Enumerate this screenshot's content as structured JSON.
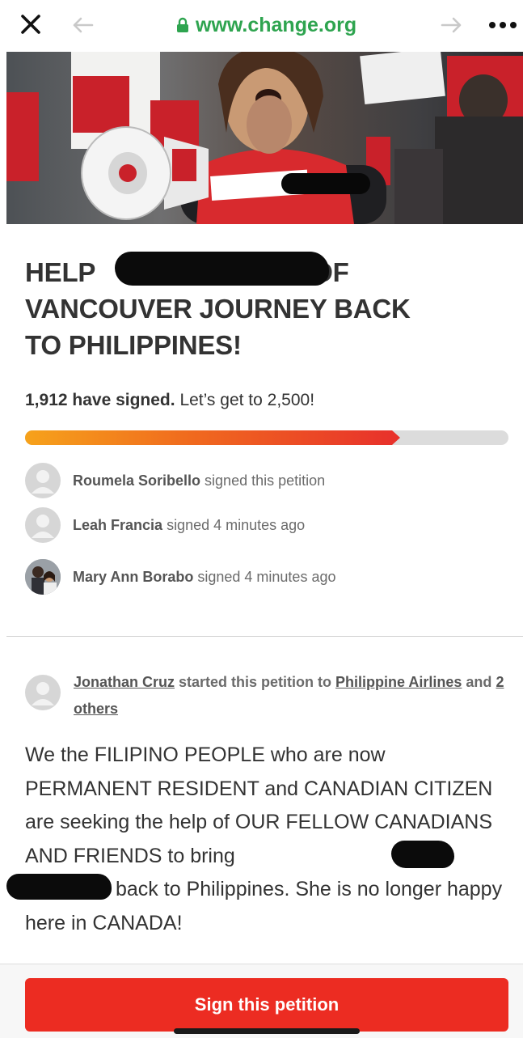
{
  "browser": {
    "url": "www.change.org",
    "icons": [
      "close-icon",
      "back-arrow-icon",
      "lock-icon",
      "forward-arrow-icon",
      "more-dots-icon"
    ]
  },
  "petition": {
    "title_line1_start": "HELP",
    "title_line1_end": "OF",
    "title_line2": "VANCOUVER JOURNEY BACK",
    "title_line3": "TO PHILIPPINES!",
    "signed_count_text": "1,912 have signed.",
    "goal_text": "Let’s get to 2,500!",
    "progress_fraction": 0.776
  },
  "signers": [
    {
      "name": "Roumela Soribello",
      "action": "signed this petition"
    },
    {
      "name": "Leah Francia",
      "action": "signed 4 minutes ago"
    },
    {
      "name": "Mary Ann Borabo",
      "action": "signed 4 minutes ago"
    }
  ],
  "starter": {
    "name": "Jonathan Cruz",
    "started_text": "started this petition to",
    "target": "Philippine Airlines",
    "and_text": "and",
    "others": "2 others"
  },
  "body": {
    "part1": "We the FILIPINO PEOPLE who are now PERMANENT RESIDENT and CANADIAN CITIZEN are seeking the help of OUR FELLOW CANADIANS AND FRIENDS to bring",
    "part2": "back to Philippines. She is no longer happy here in CANADA!"
  },
  "cta": {
    "label": "Sign this petition"
  },
  "colors": {
    "accent_red": "#ec2c22",
    "url_green": "#2ea44f",
    "progress_start": "#f6a21b",
    "progress_end": "#e8322b"
  }
}
